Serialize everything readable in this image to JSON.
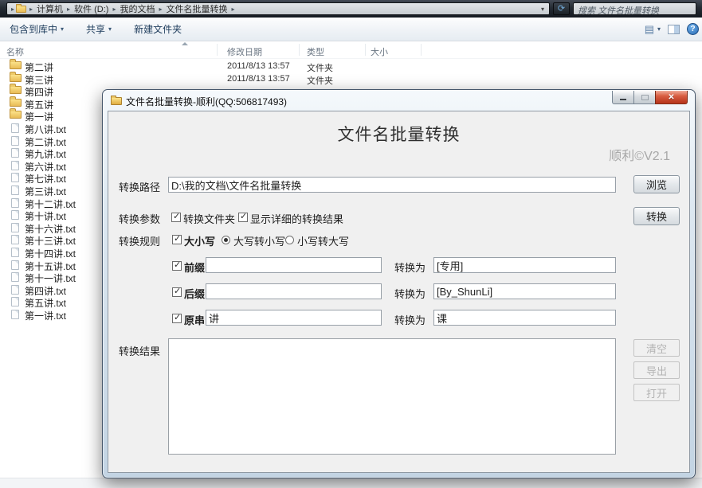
{
  "explorer": {
    "breadcrumb": [
      "计算机",
      "软件 (D:)",
      "我的文档",
      "文件名批量转换"
    ],
    "search_placeholder": "搜索 文件名批量转换",
    "toolbar": {
      "include_in_library": "包含到库中",
      "share": "共享",
      "new_folder": "新建文件夹"
    },
    "columns": {
      "name": "名称",
      "date_modified": "修改日期",
      "type": "类型",
      "size": "大小"
    },
    "items": [
      {
        "name": "第二讲",
        "kind": "folder",
        "date": "2011/8/13 13:57",
        "type": "文件夹"
      },
      {
        "name": "第三讲",
        "kind": "folder",
        "date": "2011/8/13 13:57",
        "type": "文件夹"
      },
      {
        "name": "第四讲",
        "kind": "folder",
        "date": "",
        "type": ""
      },
      {
        "name": "第五讲",
        "kind": "folder",
        "date": "",
        "type": ""
      },
      {
        "name": "第一讲",
        "kind": "folder",
        "date": "",
        "type": ""
      },
      {
        "name": "第八讲.txt",
        "kind": "file",
        "date": "",
        "type": ""
      },
      {
        "name": "第二讲.txt",
        "kind": "file",
        "date": "",
        "type": ""
      },
      {
        "name": "第九讲.txt",
        "kind": "file",
        "date": "",
        "type": ""
      },
      {
        "name": "第六讲.txt",
        "kind": "file",
        "date": "",
        "type": ""
      },
      {
        "name": "第七讲.txt",
        "kind": "file",
        "date": "",
        "type": ""
      },
      {
        "name": "第三讲.txt",
        "kind": "file",
        "date": "",
        "type": ""
      },
      {
        "name": "第十二讲.txt",
        "kind": "file",
        "date": "",
        "type": ""
      },
      {
        "name": "第十讲.txt",
        "kind": "file",
        "date": "",
        "type": ""
      },
      {
        "name": "第十六讲.txt",
        "kind": "file",
        "date": "",
        "type": ""
      },
      {
        "name": "第十三讲.txt",
        "kind": "file",
        "date": "",
        "type": ""
      },
      {
        "name": "第十四讲.txt",
        "kind": "file",
        "date": "",
        "type": ""
      },
      {
        "name": "第十五讲.txt",
        "kind": "file",
        "date": "",
        "type": ""
      },
      {
        "name": "第十一讲.txt",
        "kind": "file",
        "date": "",
        "type": ""
      },
      {
        "name": "第四讲.txt",
        "kind": "file",
        "date": "",
        "type": ""
      },
      {
        "name": "第五讲.txt",
        "kind": "file",
        "date": "",
        "type": ""
      },
      {
        "name": "第一讲.txt",
        "kind": "file",
        "date": "",
        "type": ""
      }
    ]
  },
  "dialog": {
    "title": "文件名批量转换-顺利(QQ:506817493)",
    "heading": "文件名批量转换",
    "version": "顺利©V2.1",
    "path": {
      "label": "转换路径",
      "value": "D:\\我的文档\\文件名批量转换"
    },
    "browse": "浏览",
    "params": {
      "label": "转换参数",
      "convert_folder": "转换文件夹",
      "show_detail": "显示详细的转换结果"
    },
    "convert": "转换",
    "rules": {
      "label": "转换规则",
      "case": "大小写",
      "upper_to_lower": "大写转小写",
      "lower_to_upper": "小写转大写"
    },
    "convert_to": "转换为",
    "prefix": {
      "label": "前缀",
      "value": "",
      "to": "[专用]"
    },
    "suffix": {
      "label": "后缀",
      "value": "",
      "to": "[By_ShunLi]"
    },
    "original": {
      "label": "原串",
      "value": "讲",
      "to": "课"
    },
    "result": {
      "label": "转换结果",
      "value": ""
    },
    "buttons": {
      "clear": "清空",
      "export": "导出",
      "open": "打开"
    }
  },
  "colors": {
    "close_button": "#c44a33",
    "dialog_frame": "#cdddeb",
    "content_bg": "#f0f0f0",
    "topbar": "#1c2127",
    "folder_icon": "#e9bc56"
  }
}
